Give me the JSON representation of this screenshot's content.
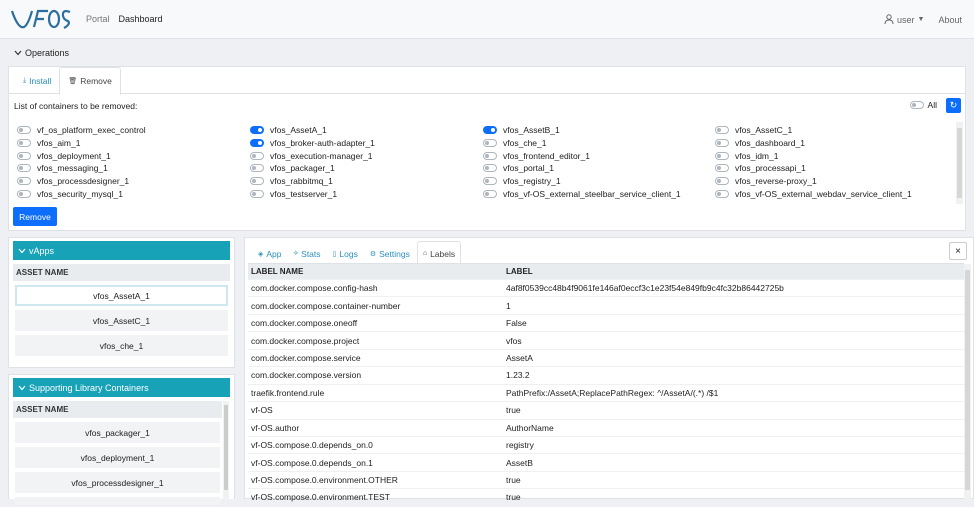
{
  "nav": {
    "logo_alt": "vf-OS",
    "links": [
      "Portal",
      "Dashboard"
    ],
    "user_label": "user",
    "about_label": "About"
  },
  "operations": {
    "title": "Operations",
    "tabs": [
      "Install",
      "Remove"
    ],
    "list_title": "List of containers to be removed:",
    "all_label": "All",
    "remove_button": "Remove",
    "containers": [
      {
        "name": "vf_os_platform_exec_control",
        "on": false
      },
      {
        "name": "vfos_AssetA_1",
        "on": true
      },
      {
        "name": "vfos_AssetB_1",
        "on": true
      },
      {
        "name": "vfos_AssetC_1",
        "on": false
      },
      {
        "name": "vfos_aim_1",
        "on": false
      },
      {
        "name": "vfos_broker-auth-adapter_1",
        "on": true
      },
      {
        "name": "vfos_che_1",
        "on": false
      },
      {
        "name": "vfos_dashboard_1",
        "on": false
      },
      {
        "name": "vfos_deployment_1",
        "on": false
      },
      {
        "name": "vfos_execution-manager_1",
        "on": false
      },
      {
        "name": "vfos_frontend_editor_1",
        "on": false
      },
      {
        "name": "vfos_idm_1",
        "on": false
      },
      {
        "name": "vfos_messaging_1",
        "on": false
      },
      {
        "name": "vfos_packager_1",
        "on": false
      },
      {
        "name": "vfos_portal_1",
        "on": false
      },
      {
        "name": "vfos_processapi_1",
        "on": false
      },
      {
        "name": "vfos_processdesigner_1",
        "on": false
      },
      {
        "name": "vfos_rabbitmq_1",
        "on": false
      },
      {
        "name": "vfos_registry_1",
        "on": false
      },
      {
        "name": "vfos_reverse-proxy_1",
        "on": false
      },
      {
        "name": "vfos_security_mysql_1",
        "on": false
      },
      {
        "name": "vfos_testserver_1",
        "on": false
      },
      {
        "name": "vfos_vf-OS_external_steelbar_service_client_1",
        "on": false
      },
      {
        "name": "vfos_vf-OS_external_webdav_service_client_1",
        "on": false
      }
    ]
  },
  "vapps": {
    "title": "vApps",
    "column": "ASSET NAME",
    "items": [
      "vfos_AssetA_1",
      "vfos_AssetC_1",
      "vfos_che_1"
    ]
  },
  "support": {
    "title": "Supporting Library Containers",
    "column": "ASSET NAME",
    "items": [
      "vfos_packager_1",
      "vfos_deployment_1",
      "vfos_processdesigner_1"
    ]
  },
  "detail": {
    "tabs": [
      "App",
      "Stats",
      "Logs",
      "Settings",
      "Labels"
    ],
    "close": "×",
    "headers": [
      "LABEL NAME",
      "LABEL"
    ],
    "rows": [
      [
        "com.docker.compose.config-hash",
        "4af8f0539cc48b4f9061fe146af0eccf3c1e23f54e849fb9c4fc32b86442725b"
      ],
      [
        "com.docker.compose.container-number",
        "1"
      ],
      [
        "com.docker.compose.oneoff",
        "False"
      ],
      [
        "com.docker.compose.project",
        "vfos"
      ],
      [
        "com.docker.compose.service",
        "AssetA"
      ],
      [
        "com.docker.compose.version",
        "1.23.2"
      ],
      [
        "traefik.frontend.rule",
        "PathPrefix:/AssetA;ReplacePathRegex: ^/AssetA/(.*) /$1"
      ],
      [
        "vf-OS",
        "true"
      ],
      [
        "vf-OS.author",
        "AuthorName"
      ],
      [
        "vf-OS.compose.0.depends_on.0",
        "registry"
      ],
      [
        "vf-OS.compose.0.depends_on.1",
        "AssetB"
      ],
      [
        "vf-OS.compose.0.environment.OTHER",
        "true"
      ],
      [
        "vf-OS.compose.0.environment.TEST",
        "true"
      ]
    ]
  },
  "colors": {
    "accent": "#17a2b8",
    "primary": "#0d6efd",
    "link": "#2a8fbd"
  }
}
